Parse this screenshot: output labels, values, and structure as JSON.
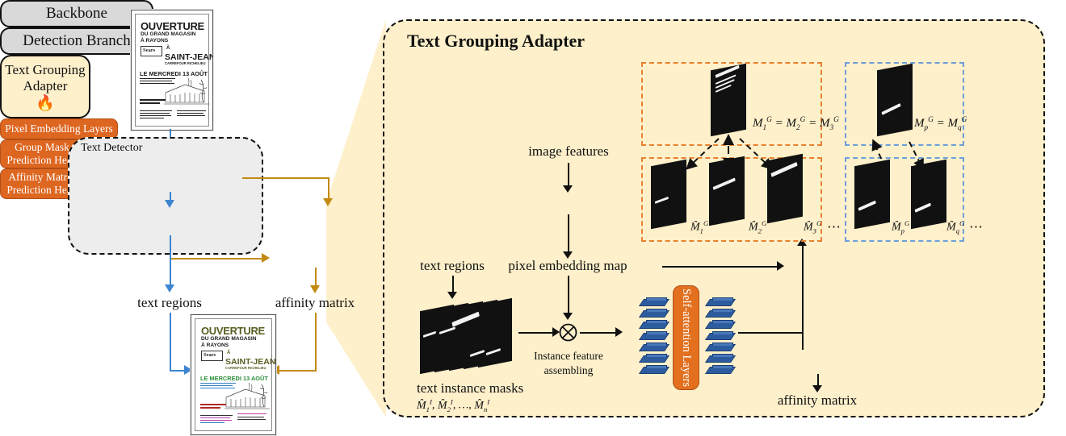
{
  "figure": {
    "title": "Text Grouping Adapter",
    "domain": "architecture-diagram"
  },
  "left_pipeline": {
    "detector_label": "Text Detector",
    "backbone_label": "Backbone",
    "detection_branch_label": "Detection Branch",
    "adapter_label_line1": "Text Grouping",
    "adapter_label_line2": "Adapter",
    "adapter_icon": "flame-icon",
    "adapter_flame": "🔥",
    "text_regions_label": "text regions",
    "affinity_matrix_label": "affinity matrix",
    "input_image_name": "scanned-poster-input",
    "output_image_name": "grouped-poster-output"
  },
  "panel": {
    "title": "Text Grouping Adapter",
    "image_features_label": "image features",
    "pixel_embedding_layers_label": "Pixel Embedding Layers",
    "pixel_embedding_map_label": "pixel embedding map",
    "text_regions_label": "text regions",
    "text_instance_masks_label": "text instance masks",
    "text_instance_masks_formula": "M̂₁ᴵ, M̂₂ᴵ, …, M̂ₙᴵ",
    "instance_feature_assembling_line1": "Instance feature",
    "instance_feature_assembling_line2": "assembling",
    "multiply_icon": "circle-times-icon",
    "self_attention_label": "Self-attention Layers",
    "group_mask_head_line1": "Group Mask",
    "group_mask_head_line2": "Prediction Head",
    "affinity_head_line1": "Affinity Matrix",
    "affinity_head_line2": "Prediction Head",
    "affinity_matrix_output_label": "affinity matrix",
    "ellipsis": "⋯"
  },
  "groups": {
    "orange_group": {
      "gt_equation_parts": [
        "M",
        "1",
        "G",
        "=",
        "M",
        "2",
        "G",
        "=",
        "M",
        "3",
        "G"
      ],
      "gt_equation_text": "M₁ᴳ = M₂ᴳ = M₃ᴳ",
      "predicted_labels": [
        "M̂₁ᴳ",
        "M̂₂ᴳ",
        "M̂₃ᴳ"
      ],
      "color": "#e8822f"
    },
    "blue_group": {
      "gt_equation_text": "Mₚᴳ = M_qᴳ",
      "predicted_labels": [
        "M̂ₚᴳ",
        "M̂_qᴳ"
      ],
      "color": "#6e9ed8"
    }
  },
  "poster": {
    "title": "OUVERTURE",
    "subtitle_line1": "DU GRAND MAGASIN",
    "subtitle_line2": "À RAYONS",
    "brand": "Sears",
    "connector": "À",
    "place": "SAINT-JEAN",
    "place_sub": "CARREFOUR RICHELIEU",
    "date": "LE MERCREDI 13 AOÛT",
    "body_line1": "Tout un rêve pour votre",
    "body_line2": "argent et … plus"
  },
  "colors": {
    "panel_bg": "#fdf0cb",
    "orange": "#dd6620",
    "blue_arrow": "#3d85d0",
    "gold_arrow": "#c28a12",
    "detector_bg": "#ededed",
    "gray_box": "#d9d9d9",
    "token_blue": "#2d5c9e",
    "group_orange": "#e8822f",
    "group_blue": "#6e9ed8"
  }
}
